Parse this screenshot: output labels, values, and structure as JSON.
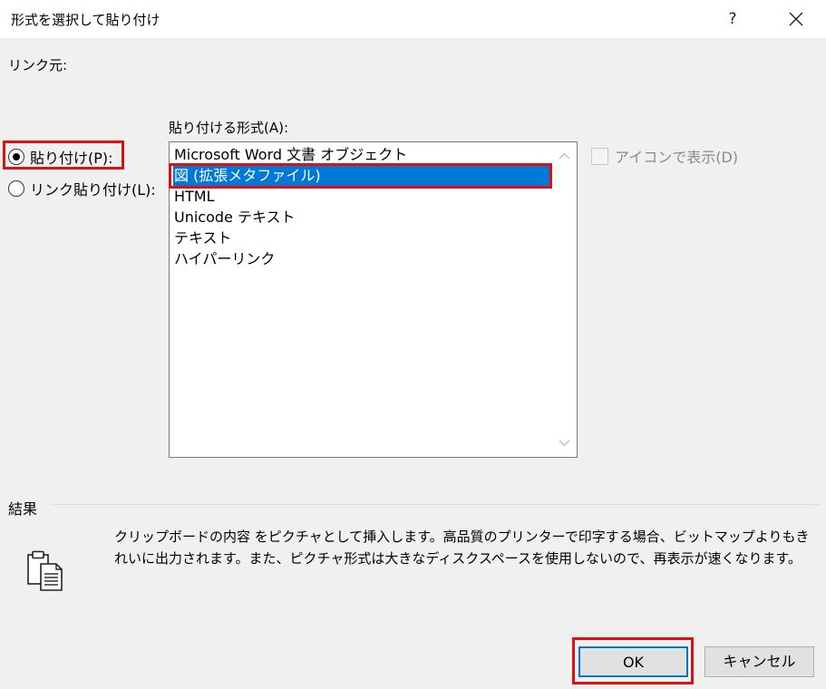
{
  "window": {
    "title": "形式を選択して貼り付け",
    "help_label": "?"
  },
  "source": {
    "label": "リンク元:"
  },
  "paste_options": {
    "paste_label": "貼り付け(P):",
    "link_label": "リンク貼り付け(L):",
    "selected": "paste"
  },
  "format_list": {
    "label": "貼り付ける形式(A):",
    "items": [
      "Microsoft Word 文書 オブジェクト",
      "図 (拡張メタファイル)",
      "HTML",
      "Unicode テキスト",
      "テキスト",
      "ハイパーリンク"
    ],
    "selected_index": 1
  },
  "display_as_icon": {
    "label": "アイコンで表示(D)",
    "checked": false,
    "enabled": false
  },
  "result": {
    "label": "結果",
    "description": "クリップボードの内容 をピクチャとして挿入します。高品質のプリンターで印字する場合、ビットマップよりもきれいに出力されます。また、ピクチャ形式は大きなディスクスペースを使用しないので、再表示が速くなります。",
    "icon": "clipboard-paste-icon"
  },
  "buttons": {
    "ok_label": "OK",
    "cancel_label": "キャンセル"
  },
  "colors": {
    "selection": "#0078d7",
    "highlight_annotation": "#e01010"
  }
}
